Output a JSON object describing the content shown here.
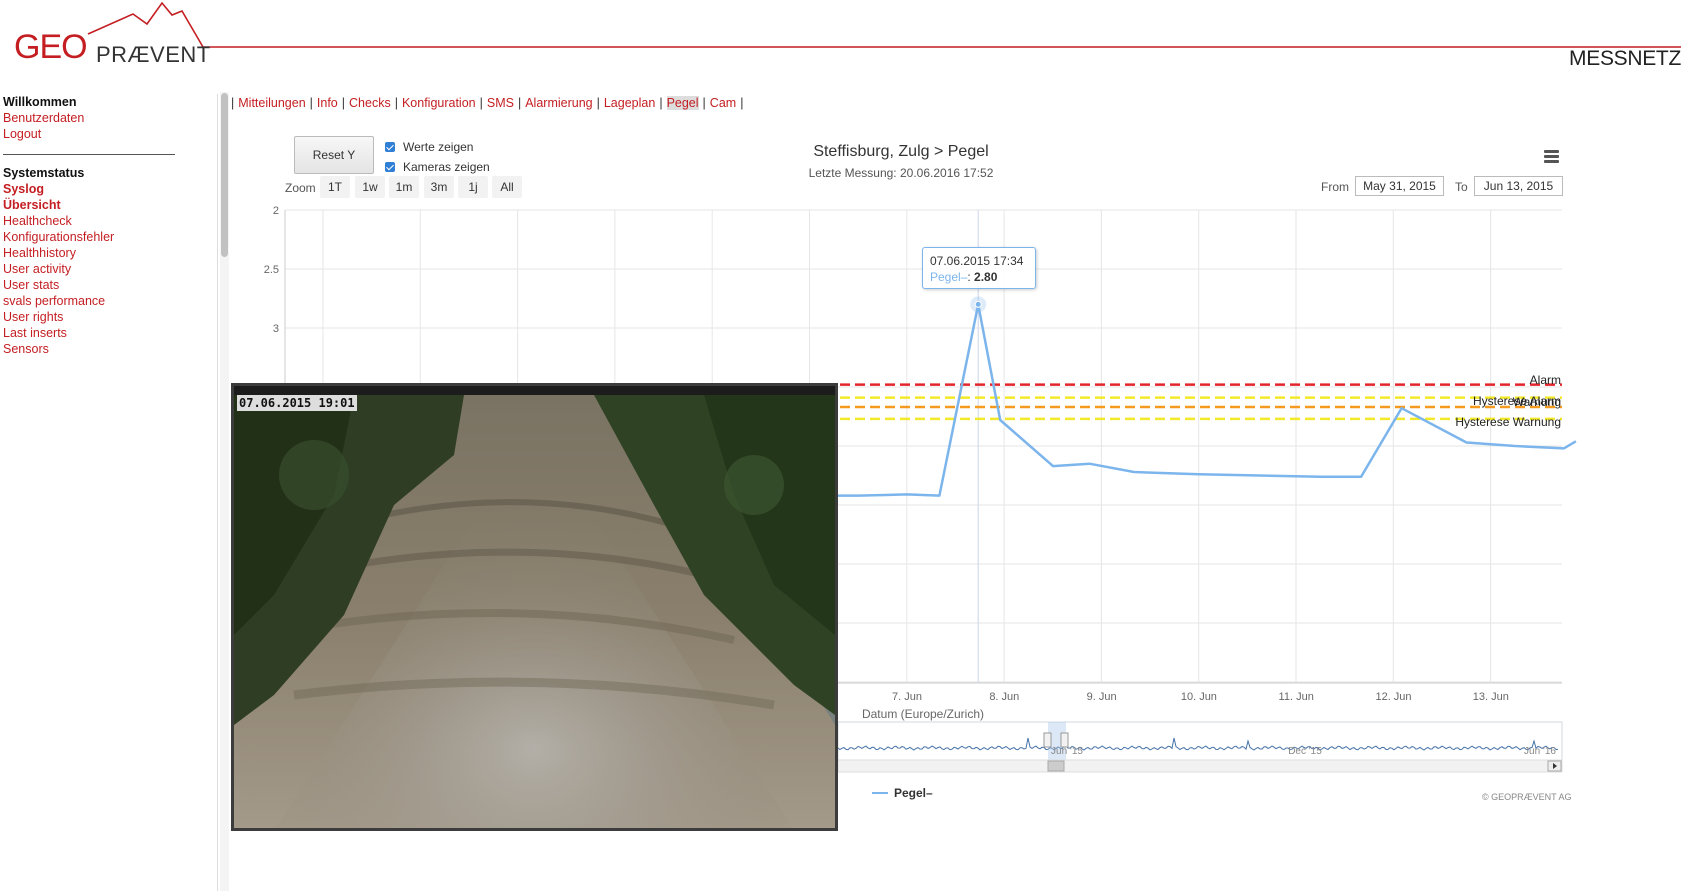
{
  "header": {
    "logo_geo": "GEO",
    "logo_rest": "PRÆVENT",
    "right_title": "MESSNETZ",
    "brand_color": "#c41e22"
  },
  "sidebar": {
    "section1": [
      {
        "label": "Willkommen",
        "style": "heading"
      },
      {
        "label": "Benutzerdaten",
        "style": "link"
      },
      {
        "label": "Logout",
        "style": "link"
      }
    ],
    "section2": [
      {
        "label": "Systemstatus",
        "style": "heading"
      },
      {
        "label": "Syslog",
        "style": "active"
      },
      {
        "label": "Übersicht",
        "style": "active"
      },
      {
        "label": "Healthcheck",
        "style": "link"
      },
      {
        "label": "Konfigurationsfehler",
        "style": "link"
      },
      {
        "label": "Healthhistory",
        "style": "link"
      },
      {
        "label": "User activity",
        "style": "link"
      },
      {
        "label": "User stats",
        "style": "link"
      },
      {
        "label": "svals performance",
        "style": "link"
      },
      {
        "label": "User rights",
        "style": "link"
      },
      {
        "label": "Last inserts",
        "style": "link"
      },
      {
        "label": "Sensors",
        "style": "link"
      }
    ]
  },
  "nav": {
    "items": [
      "Mitteilungen",
      "Info",
      "Checks",
      "Konfiguration",
      "SMS",
      "Alarmierung",
      "Lageplan",
      "Pegel",
      "Cam"
    ],
    "active": "Pegel"
  },
  "controls": {
    "reset_label": "Reset Y",
    "checkbox_values": "Werte zeigen",
    "checkbox_cameras": "Kameras zeigen",
    "zoom_label": "Zoom",
    "zoom_buttons": [
      "1T",
      "1w",
      "1m",
      "3m",
      "1j",
      "All"
    ],
    "from_label": "From",
    "from_value": "May 31, 2015",
    "to_label": "To",
    "to_value": "Jun 13, 2015"
  },
  "tooltip": {
    "date": "07.06.2015 17:34",
    "series": "Pegel–",
    "value": "2.80"
  },
  "camera": {
    "timestamp": "07.06.2015 19:01"
  },
  "credits": "© GEOPRÆVENT AG",
  "chart_data": {
    "type": "line",
    "title": "Steffisburg, Zulg > Pegel",
    "subtitle": "Letzte Messung: 20.06.2016 17:52",
    "xlabel": "Datum (Europe/Zurich)",
    "ylabel": "",
    "y_reversed": true,
    "y_ticks": [
      "2",
      "2.5",
      "3"
    ],
    "x_ticks": [
      "7. Jun",
      "8. Jun",
      "9. Jun",
      "10. Jun",
      "11. Jun",
      "12. Jun",
      "13. Jun"
    ],
    "navigator_labels": [
      "Jun '15",
      "Dec '15",
      "Jun '16"
    ],
    "series": [
      {
        "name": "Pegel–",
        "color": "#7cb5ec",
        "x": [
          "06.06 12:00",
          "07.06 00:00",
          "07.06 08:00",
          "07.06 17:34",
          "07.06 23:00",
          "08.06 12:00",
          "08.06 21:00",
          "09.06 08:00",
          "10.06 00:00",
          "11.06 06:00",
          "11.06 16:00",
          "12.06 02:00",
          "12.06 18:00",
          "13.06 06:00",
          "13.06 18:00",
          "13.06 21:00"
        ],
        "values": [
          4.42,
          4.41,
          4.42,
          2.8,
          3.78,
          4.17,
          4.15,
          4.22,
          4.24,
          4.26,
          4.26,
          3.68,
          3.97,
          4.0,
          4.02,
          3.96
        ]
      }
    ],
    "thresholds": [
      {
        "label": "Alarm",
        "value": 3.48,
        "color": "#e3262d"
      },
      {
        "label": "Hysterese Alarm",
        "value": 3.59,
        "color": "#f2e92b"
      },
      {
        "label": "Warnung",
        "value": 3.67,
        "color": "#f59a1f"
      },
      {
        "label": "Hysterese Warnung",
        "value": 3.77,
        "color": "#f2e92b"
      }
    ],
    "legend": "bottom",
    "grid": true
  }
}
